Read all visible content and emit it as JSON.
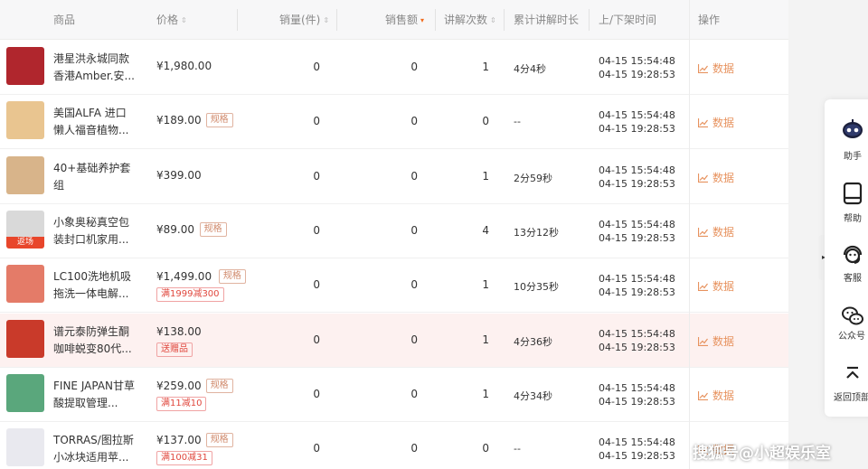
{
  "header": {
    "product": "商品",
    "price": "价格",
    "sales_qty": "销量(件)",
    "sales_amount": "销售额",
    "explain_count": "讲解次数",
    "explain_total": "累计讲解时长",
    "shelf_time": "上/下架时间",
    "action": "操作"
  },
  "sort_icons": {
    "inactive": "⇕",
    "active": "▾"
  },
  "rows": [
    {
      "name": "港星洪永城同款香港Amber.安...",
      "price": "¥1,980.00",
      "spec": "",
      "promo": "",
      "qty": "0",
      "amount": "0",
      "explain_count": "1",
      "explain_total": "4分4秒",
      "on_time": "04-15  15:54:48",
      "off_time": "04-15  19:28:53",
      "action": "数据",
      "thumb_color": "#b0262d",
      "thumb_tag": ""
    },
    {
      "name": "美国ALFA 进口懒人福音植物...",
      "price": "¥189.00",
      "spec": "规格",
      "promo": "",
      "qty": "0",
      "amount": "0",
      "explain_count": "0",
      "explain_total": "--",
      "on_time": "04-15  15:54:48",
      "off_time": "04-15  19:28:53",
      "action": "数据",
      "thumb_color": "#e9c590",
      "thumb_tag": ""
    },
    {
      "name": "40+基础养护套组",
      "price": "¥399.00",
      "spec": "",
      "promo": "",
      "qty": "0",
      "amount": "0",
      "explain_count": "1",
      "explain_total": "2分59秒",
      "on_time": "04-15  15:54:48",
      "off_time": "04-15  19:28:53",
      "action": "数据",
      "thumb_color": "#d8b48a",
      "thumb_tag": ""
    },
    {
      "name": "小象奥秘真空包装封口机家用...",
      "price": "¥89.00",
      "spec": "规格",
      "promo": "",
      "qty": "0",
      "amount": "0",
      "explain_count": "4",
      "explain_total": "13分12秒",
      "on_time": "04-15  15:54:48",
      "off_time": "04-15  19:28:53",
      "action": "数据",
      "thumb_color": "#d9d9d9",
      "thumb_tag": "返场"
    },
    {
      "name": "LC100洗地机吸拖洗一体电解...",
      "price": "¥1,499.00",
      "spec": "规格",
      "promo": "满1999减300",
      "qty": "0",
      "amount": "0",
      "explain_count": "1",
      "explain_total": "10分35秒",
      "on_time": "04-15  15:54:48",
      "off_time": "04-15  19:28:53",
      "action": "数据",
      "thumb_color": "#e47b68",
      "thumb_tag": ""
    },
    {
      "name": "谱元泰防弹生酮咖啡蜕变80代...",
      "price": "¥138.00",
      "spec": "",
      "promo": "送赠品",
      "qty": "0",
      "amount": "0",
      "explain_count": "1",
      "explain_total": "4分36秒",
      "on_time": "04-15  15:54:48",
      "off_time": "04-15  19:28:53",
      "action": "数据",
      "thumb_color": "#c93a2a",
      "thumb_tag": ""
    },
    {
      "name": "FINE JAPAN甘草酸提取管理...",
      "price": "¥259.00",
      "spec": "规格",
      "promo": "满11减10",
      "qty": "0",
      "amount": "0",
      "explain_count": "1",
      "explain_total": "4分34秒",
      "on_time": "04-15  15:54:48",
      "off_time": "04-15  19:28:53",
      "action": "数据",
      "thumb_color": "#5aa77c",
      "thumb_tag": ""
    },
    {
      "name": "TORRAS/图拉斯小冰块适用苹...",
      "price": "¥137.00",
      "spec": "规格",
      "promo": "满100减31",
      "qty": "0",
      "amount": "0",
      "explain_count": "0",
      "explain_total": "--",
      "on_time": "04-15  15:54:48",
      "off_time": "04-15  19:28:53",
      "action": "数据",
      "thumb_color": "#e9e9ef",
      "thumb_tag": ""
    }
  ],
  "side_panel": [
    {
      "label": "助手",
      "icon": "robot-icon"
    },
    {
      "label": "帮助",
      "icon": "book-icon"
    },
    {
      "label": "客服",
      "icon": "service-icon"
    },
    {
      "label": "公众号",
      "icon": "wechat-icon"
    },
    {
      "label": "返回顶部",
      "icon": "back-to-top-icon"
    }
  ],
  "collapse_glyph": "▸",
  "watermark": "搜狐号@小超娱乐室",
  "colors": {
    "accent": "#e7925e",
    "highlight_row": "#fdf1f0",
    "promo_red": "#e0473d",
    "sort_active": "#f26a1b"
  }
}
